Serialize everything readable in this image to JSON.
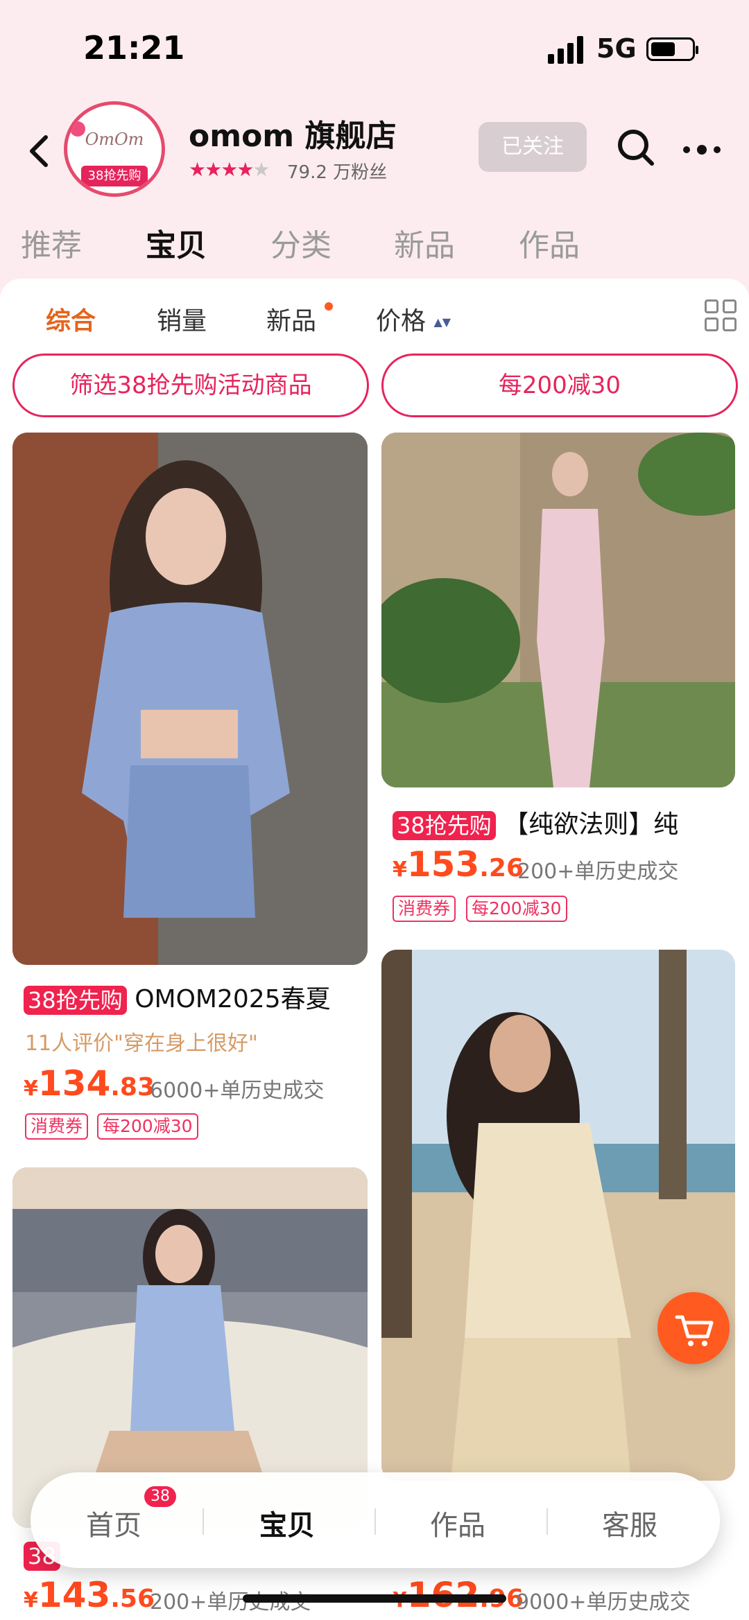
{
  "status_bar": {
    "time": "21:21",
    "network": "5G"
  },
  "shop": {
    "logo_text": "OmOm",
    "logo_badge": "38抢先购",
    "name": "omom 旗舰店",
    "rating_stars": "★★★★",
    "rating_stars_off": "★",
    "fans": "79.2 万粉丝",
    "follow_label": "已关注"
  },
  "tabs": [
    "推荐",
    "宝贝",
    "分类",
    "新品",
    "作品"
  ],
  "sort_bar": {
    "items": [
      "综合",
      "销量",
      "新品",
      "价格"
    ],
    "price_arrow": "▲▼"
  },
  "filter_pills": [
    "筛选38抢先购活动商品",
    "每200减30"
  ],
  "products": [
    {
      "tag": "38抢先购",
      "title": "OMOM2025春夏",
      "review": "11人评价\"穿在身上很好\"",
      "price_symbol": "¥",
      "price_int": "134",
      "price_dec": ".83",
      "sold": "6000+单历史成交",
      "coupons": [
        "消费券",
        "每200减30"
      ]
    },
    {
      "tag": "38抢先购",
      "title": "【纯欲法则】纯",
      "price_symbol": "¥",
      "price_int": "153",
      "price_dec": ".26",
      "sold": "200+单历史成交",
      "coupons": [
        "消费券",
        "每200减30"
      ]
    },
    {
      "tag": "38",
      "price_symbol": "¥",
      "price_int": "143",
      "price_dec": ".56",
      "sold": "200+单历史成交"
    },
    {
      "price_symbol": "¥",
      "price_int": "162",
      "price_dec": ".96",
      "sold": "9000+单历史成交"
    }
  ],
  "bottom_nav": {
    "items": [
      "首页",
      "宝贝",
      "作品",
      "客服"
    ],
    "badge": "38"
  },
  "colors": {
    "accent": "#e6245c",
    "price": "#ff4a1d",
    "sort_active": "#e4641e"
  }
}
